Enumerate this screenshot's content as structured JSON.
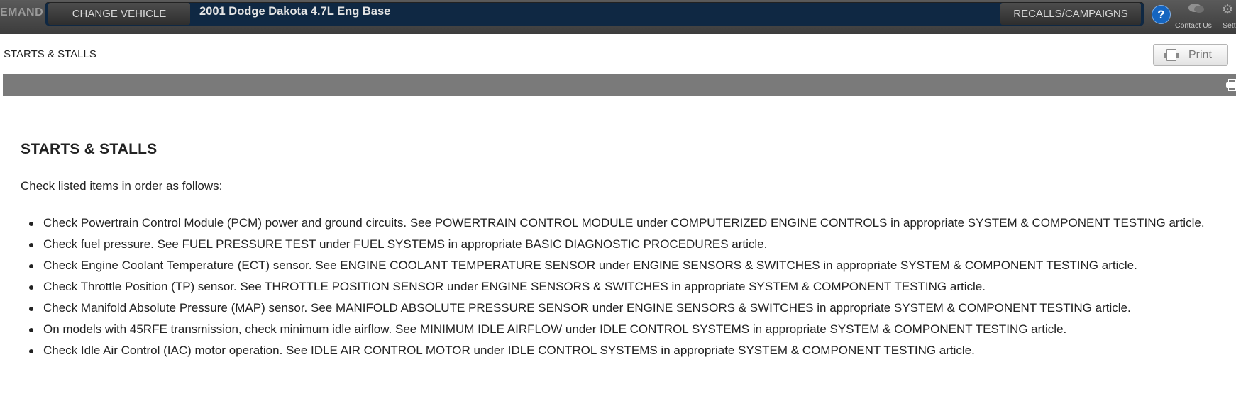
{
  "header": {
    "brand": "EMAND",
    "change_vehicle": "CHANGE VEHICLE",
    "vehicle_title": "2001 Dodge Dakota 4.7L Eng Base",
    "recalls": "RECALLS/CAMPAIGNS",
    "help": "?",
    "contact_us": "Contact Us",
    "settings": "Settings"
  },
  "page": {
    "breadcrumb": "STARTS & STALLS",
    "print": "Print"
  },
  "article": {
    "title": "STARTS & STALLS",
    "intro": "Check listed items in order as follows:",
    "items": [
      "Check Powertrain Control Module (PCM) power and ground circuits. See POWERTRAIN CONTROL MODULE under COMPUTERIZED ENGINE CONTROLS in appropriate SYSTEM & COMPONENT TESTING article.",
      "Check fuel pressure. See FUEL PRESSURE TEST under FUEL SYSTEMS in appropriate BASIC DIAGNOSTIC PROCEDURES article.",
      "Check Engine Coolant Temperature (ECT) sensor. See ENGINE COOLANT TEMPERATURE SENSOR under ENGINE SENSORS & SWITCHES in appropriate SYSTEM & COMPONENT TESTING article.",
      "Check Throttle Position (TP) sensor. See THROTTLE POSITION SENSOR under ENGINE SENSORS & SWITCHES in appropriate SYSTEM & COMPONENT TESTING article.",
      "Check Manifold Absolute Pressure (MAP) sensor. See MANIFOLD ABSOLUTE PRESSURE SENSOR under ENGINE SENSORS & SWITCHES in appropriate SYSTEM & COMPONENT TESTING article.",
      "On models with 45RFE transmission, check minimum idle airflow. See MINIMUM IDLE AIRFLOW under IDLE CONTROL SYSTEMS in appropriate SYSTEM & COMPONENT TESTING article.",
      "Check Idle Air Control (IAC) motor operation. See IDLE AIR CONTROL MOTOR under IDLE CONTROL SYSTEMS in appropriate SYSTEM & COMPONENT TESTING article."
    ]
  },
  "colors": {
    "topbar": "#474747",
    "vehicle_bar": "#0f2843",
    "help_button": "#1565c0",
    "gray_bar": "#7a7a7a"
  },
  "icons": [
    "help-icon",
    "contact-us-icon",
    "settings-gear-icon",
    "printer-icon"
  ]
}
